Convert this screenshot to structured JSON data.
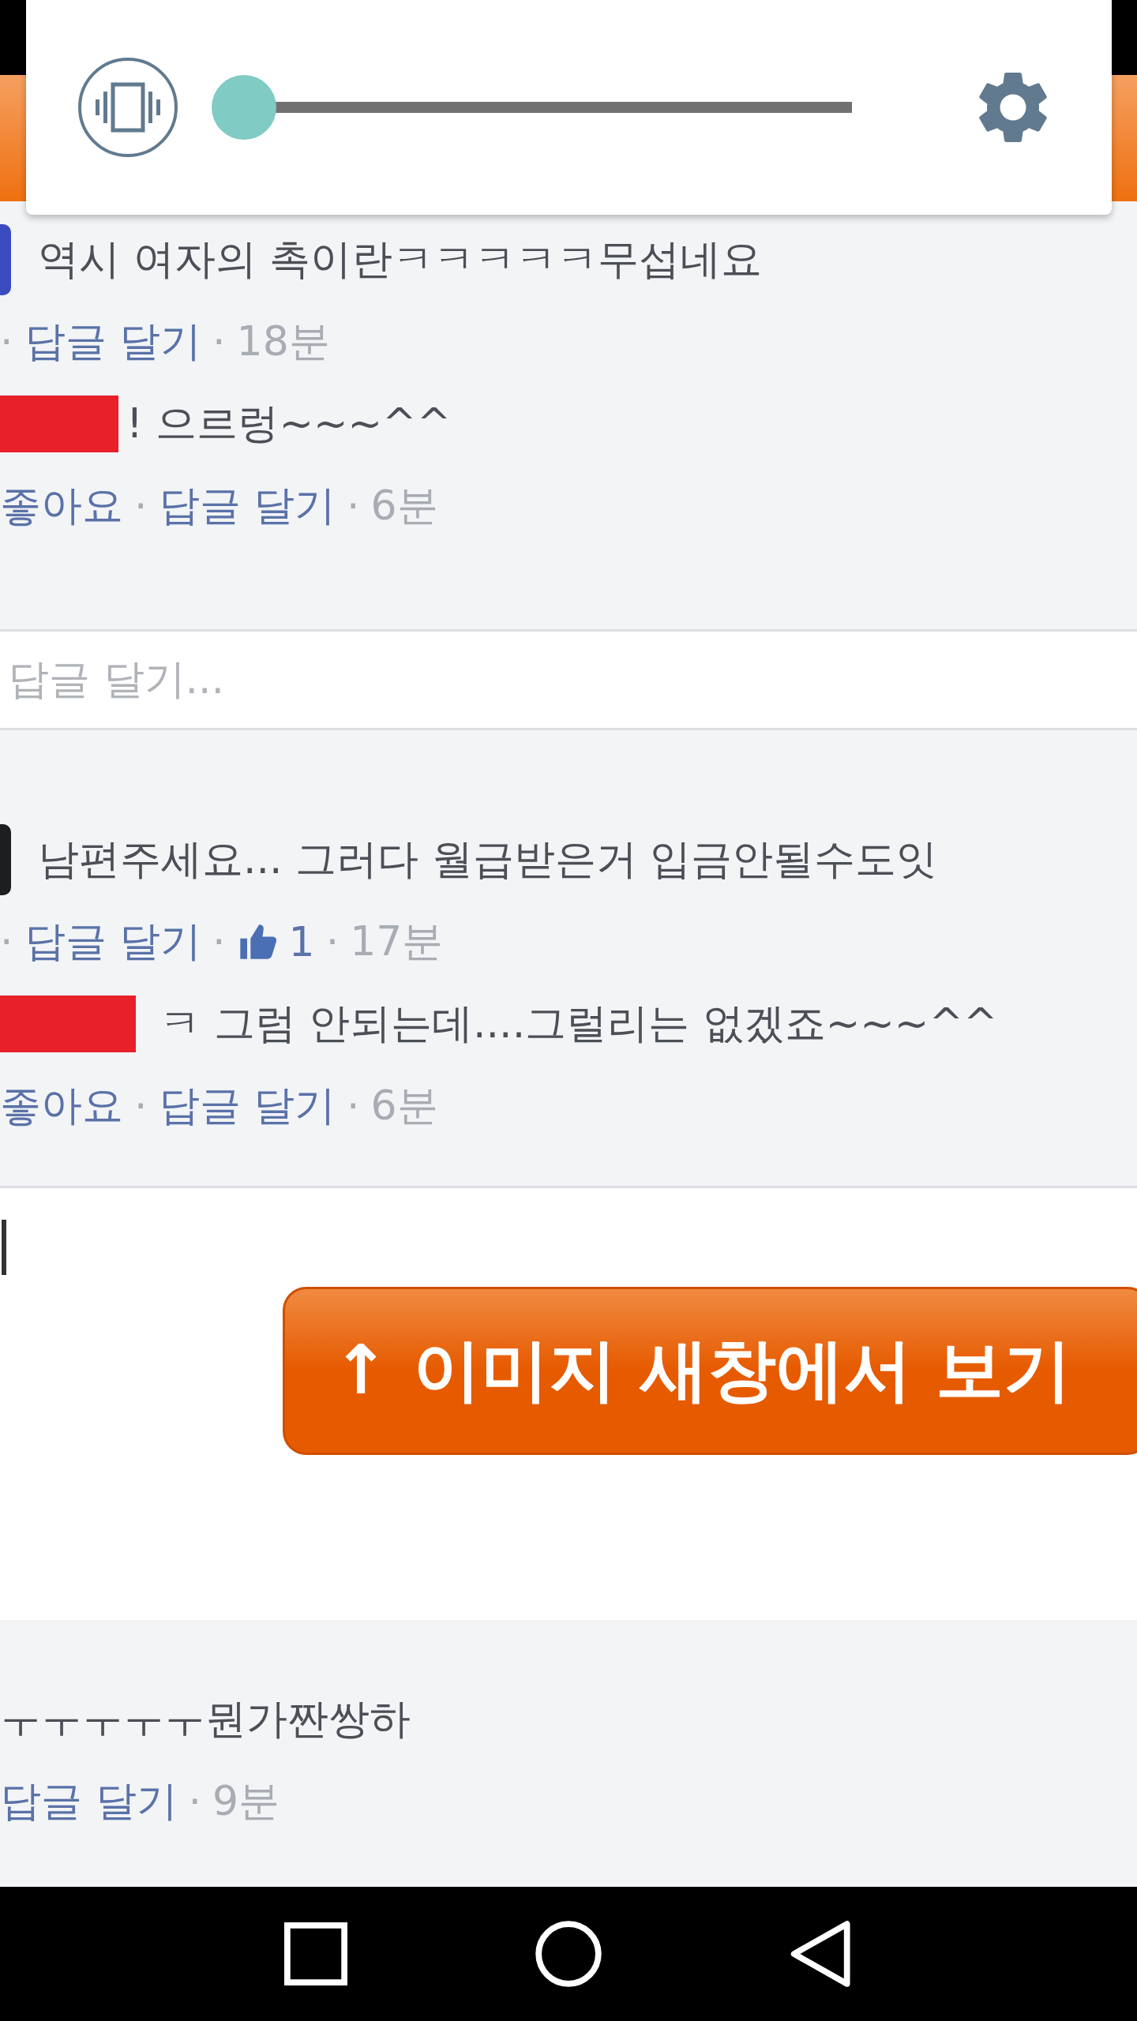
{
  "volume_panel": {
    "level": 0
  },
  "threads": [
    {
      "comment": {
        "color": "#3b4cc0",
        "text": "역시 여자의 촉이란ㅋㅋㅋㅋㅋ무섭네요",
        "meta": [
          {
            "kind": "sep",
            "text": "·"
          },
          {
            "kind": "link",
            "text": "답글 달기"
          },
          {
            "kind": "sep",
            "text": "·"
          },
          {
            "kind": "time",
            "text": "18분"
          }
        ]
      },
      "replies": [
        {
          "text": "! 으르렁~~~^^",
          "meta": [
            {
              "kind": "link",
              "text": "좋아요"
            },
            {
              "kind": "sep",
              "text": "·"
            },
            {
              "kind": "link",
              "text": "답글 달기"
            },
            {
              "kind": "sep",
              "text": "·"
            },
            {
              "kind": "time",
              "text": "6분"
            }
          ]
        }
      ],
      "reply_field": {
        "placeholder": "답글 달기..."
      }
    },
    {
      "comment": {
        "color": "#1c1e21",
        "text": "남편주세요... 그러다 월급받은거 입금안될수도잇",
        "meta": [
          {
            "kind": "sep",
            "text": "·"
          },
          {
            "kind": "link",
            "text": "답글 달기"
          },
          {
            "kind": "sep",
            "text": "·"
          },
          {
            "kind": "likes",
            "text": "1"
          },
          {
            "kind": "sep",
            "text": "·"
          },
          {
            "kind": "time",
            "text": "17분"
          }
        ]
      },
      "replies": [
        {
          "text": "ㅋ 그럼 안되는데....그럴리는 없겠죠~~~^^",
          "meta": [
            {
              "kind": "link",
              "text": "좋아요"
            },
            {
              "kind": "sep",
              "text": "·"
            },
            {
              "kind": "link",
              "text": "답글 달기"
            },
            {
              "kind": "sep",
              "text": "·"
            },
            {
              "kind": "time",
              "text": "6분"
            }
          ]
        }
      ]
    }
  ],
  "open_image_button": "↑ 이미지 새창에서 보기",
  "last_comment": {
    "text": "ㅜㅜㅜㅜㅜ뭔가짠쌍하",
    "meta": [
      {
        "kind": "link",
        "text": "답글 달기"
      },
      {
        "kind": "sep",
        "text": "·"
      },
      {
        "kind": "time",
        "text": "9분"
      }
    ]
  }
}
